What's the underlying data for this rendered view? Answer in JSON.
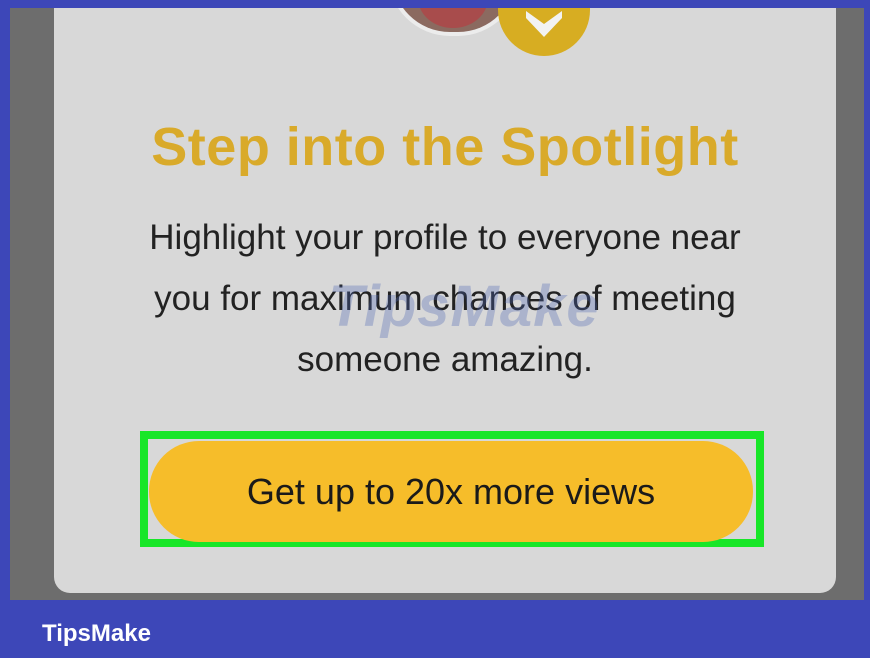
{
  "card": {
    "title": "Step into the Spotlight",
    "description": "Highlight your profile to everyone near you for maximum chances of meeting someone amazing.",
    "button_label": "Get up to 20x more views"
  },
  "overlay": {
    "watermark_text": "TipsMake",
    "footer_brand": "TipsMake"
  },
  "colors": {
    "accent_gold": "#d9aa2a",
    "button_yellow": "#f6bd2a",
    "highlight_green": "#18e628",
    "frame_blue": "#3d47b8"
  }
}
